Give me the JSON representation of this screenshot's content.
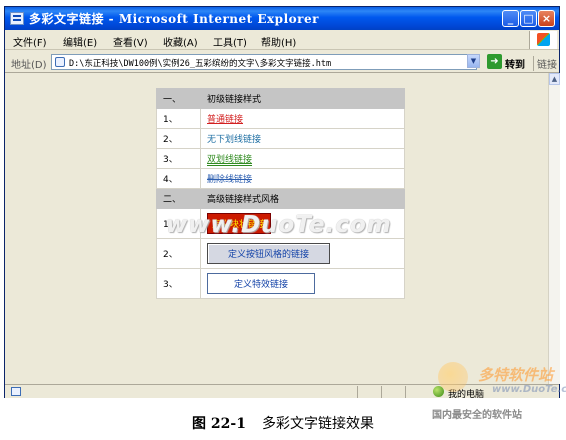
{
  "window": {
    "title": "多彩文字链接 - Microsoft Internet Explorer",
    "minimize": "_",
    "maximize": "□",
    "close": "×"
  },
  "menu": [
    "文件(F)",
    "编辑(E)",
    "查看(V)",
    "收藏(A)",
    "工具(T)",
    "帮助(H)"
  ],
  "address": {
    "label": "地址(D)",
    "value": "D:\\东正科技\\DW100例\\实例26_五彩缤纷的文字\\多彩文字链接.htm",
    "go": "转到",
    "links": "链接"
  },
  "content": {
    "section1": {
      "num": "一、",
      "title": "初级链接样式"
    },
    "basic_links": [
      {
        "num": "1、",
        "label": "普通链接"
      },
      {
        "num": "2、",
        "label": "无下划线链接"
      },
      {
        "num": "3、",
        "label": "双划线链接"
      },
      {
        "num": "4、",
        "label": "删除线链接"
      }
    ],
    "section2": {
      "num": "二、",
      "title": "高级链接样式风格"
    },
    "advanced_links": [
      {
        "num": "1、",
        "label": "定义块状链接"
      },
      {
        "num": "2、",
        "label": "定义按钮风格的链接"
      },
      {
        "num": "3、",
        "label": "定义特效链接"
      }
    ],
    "watermark": "www.DuoTe.com"
  },
  "status": {
    "zone": "我的电脑"
  },
  "corner_logo": {
    "cn": "多特软件站",
    "en": "www.DuoTe.com",
    "slogan": "国内最安全的软件站"
  },
  "caption": {
    "number": "图 22-1",
    "text": "多彩文字链接效果"
  }
}
